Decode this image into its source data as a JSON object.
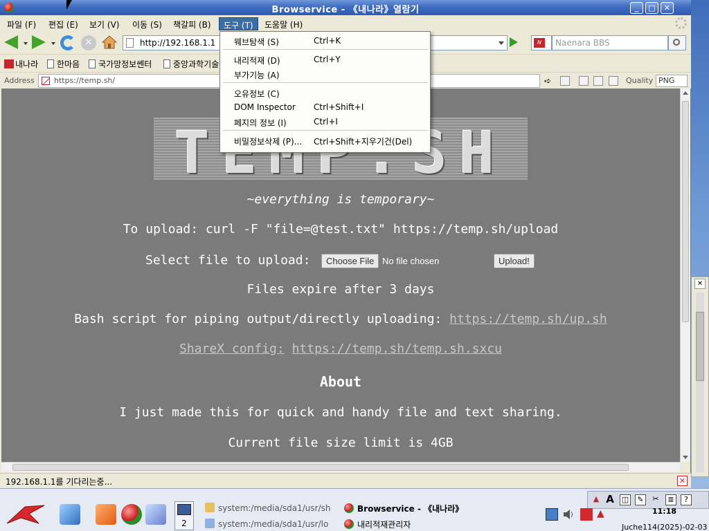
{
  "window": {
    "title": "Browservice - 《내나라》열람기"
  },
  "menubar": {
    "items": [
      "파일 (F)",
      "편집 (E)",
      "보기 (V)",
      "이동 (S)",
      "책갈피 (B)",
      "도구 (T)",
      "도움말 (H)"
    ],
    "active": "도구 (T)"
  },
  "navbar": {
    "url": "http://192.168.1.1",
    "search_placeholder": "Naenara BBS"
  },
  "bookmarks": [
    "내나라",
    "한마음",
    "국가망정보쎈터",
    "중앙과학기술"
  ],
  "addressbar": {
    "label": "Address",
    "url": "https://temp.sh/",
    "quality_label": "Quality",
    "format": "PNG"
  },
  "tools_menu": {
    "items": [
      {
        "label": "웨브탐색 (S)",
        "shortcut": "Ctrl+K"
      },
      {
        "label": "내리적재 (D)",
        "shortcut": "Ctrl+Y"
      },
      {
        "label": "부가기능 (A)",
        "shortcut": ""
      },
      {
        "label": "오유정보 (C)",
        "shortcut": ""
      },
      {
        "label": "DOM Inspector",
        "shortcut": "Ctrl+Shift+I"
      },
      {
        "label": "페지의 정보 (I)",
        "shortcut": "Ctrl+I"
      },
      {
        "label": "비밀정보삭제 (P)...",
        "shortcut": "Ctrl+Shift+지우기건(Del)"
      }
    ]
  },
  "page": {
    "logo_text": "TEMP.SH",
    "tagline": "~everything is temporary~",
    "upload_cmd": "To upload: curl -F \"file=@test.txt\" https://temp.sh/upload",
    "select_label": "Select file to upload:",
    "choose_file": "Choose File",
    "no_file": "No file chosen",
    "upload_button": "Upload!",
    "expire": "Files expire after 3 days",
    "bash_prefix": "Bash script for piping output/directly uploading: ",
    "bash_link": "https://temp.sh/up.sh",
    "sharex_prefix": "ShareX config:",
    "sharex_link": "https://temp.sh/temp.sh.sxcu",
    "about_heading": "About",
    "about_text": "I just made this for quick and handy file and text sharing.",
    "limit_text": "Current file size limit is 4GB"
  },
  "statusbar": {
    "text": "192.168.1.1를 기다리는중..."
  },
  "taskbar": {
    "workspace_number": "2",
    "tasks": [
      {
        "label": "system:/media/sda1/usr/sh",
        "active": false
      },
      {
        "label": "Browservice - 《내나라》",
        "active": true
      },
      {
        "label": "system:/media/sda1/usr/lo",
        "active": false
      },
      {
        "label": "내리적재관리자",
        "active": false
      }
    ],
    "clock": "11:18",
    "date": "Juche114(2025)-02-03"
  },
  "colors": {
    "title_bar": "#3e6cc0",
    "page_background": "#7b7b7b",
    "menu_highlight": "#3a6ea5",
    "brand_red": "#c1272d"
  }
}
